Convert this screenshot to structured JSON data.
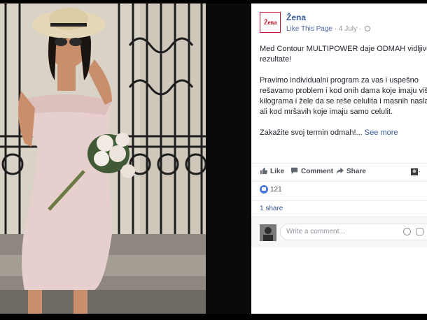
{
  "post": {
    "page_name": "Žena",
    "logo_text": "Žena",
    "meta_link": "Like This Page",
    "meta_separator": "·",
    "date": "4 July",
    "date_separator": "·",
    "paragraph1": [
      "Med Contour MULTIPOWER daje ODMAH vidljive",
      "rezultate!"
    ],
    "paragraph2": [
      "Pravimo individualni program za vas i uspešno",
      "rešavamo problem i kod onih dama koje imaju višak",
      "kilograma i žele da se reše celulita i masnih naslaga",
      "ali kod mršavih koje imaju samo celulit."
    ],
    "paragraph3_text": "Zakažite svoj termin odmah!...",
    "see_more": "See more"
  },
  "actions": {
    "like": "Like",
    "comment": "Comment",
    "share": "Share"
  },
  "stats": {
    "reactions_count": "121",
    "shares": "1 share"
  },
  "comment_box": {
    "placeholder": "Write a comment..."
  },
  "icons": [
    "like-thumb-icon",
    "comment-bubble-icon",
    "share-arrow-icon",
    "viewer-selector-icon",
    "globe-icon",
    "emoji-icon",
    "sticker-icon"
  ],
  "colors": {
    "link": "#365899",
    "brand_red": "#c0192c",
    "like_blue": "#4a76d9"
  }
}
